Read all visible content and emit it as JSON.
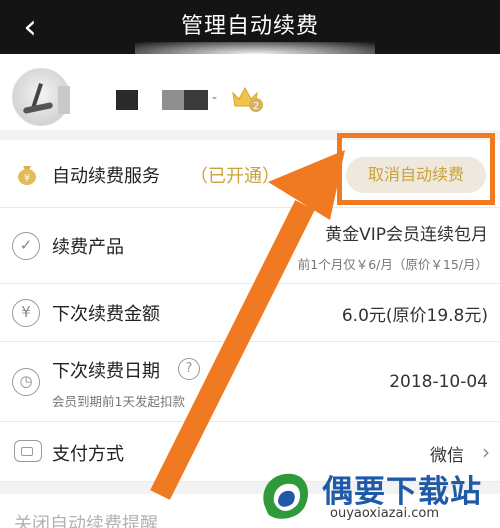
{
  "header": {
    "title": "管理自动续费",
    "back_icon": "chevron-left-icon"
  },
  "user": {
    "separator": "-",
    "vip_level": "2",
    "avatar_icon": "avatar-icon",
    "badge_icon": "crown-icon"
  },
  "service": {
    "label": "自动续费服务",
    "status": "（已开通）",
    "cancel_label": "取消自动续费",
    "icon": "money-bag-icon"
  },
  "product": {
    "label": "续费产品",
    "name": "黄金VIP会员连续包月",
    "price_note": "前1个月仅￥6/月（原价￥15/月）",
    "icon": "check-circle-icon"
  },
  "amount": {
    "label": "下次续费金额",
    "value": "6.0元(原价19.8元)",
    "icon": "yen-icon"
  },
  "date": {
    "label": "下次续费日期",
    "value": "2018-10-04",
    "note": "会员到期前1天发起扣款",
    "help": "?",
    "icon": "clock-icon"
  },
  "payment": {
    "label": "支付方式",
    "value": "微信",
    "icon": "card-icon"
  },
  "bottom": {
    "text": "关闭自动续费提醒"
  },
  "colors": {
    "accent_gold": "#c9a23a",
    "highlight_orange": "#f07a22",
    "header_bg": "#141414"
  },
  "watermark": {
    "title": "偶要下载站",
    "url": "ouyaoxiazai.com"
  }
}
